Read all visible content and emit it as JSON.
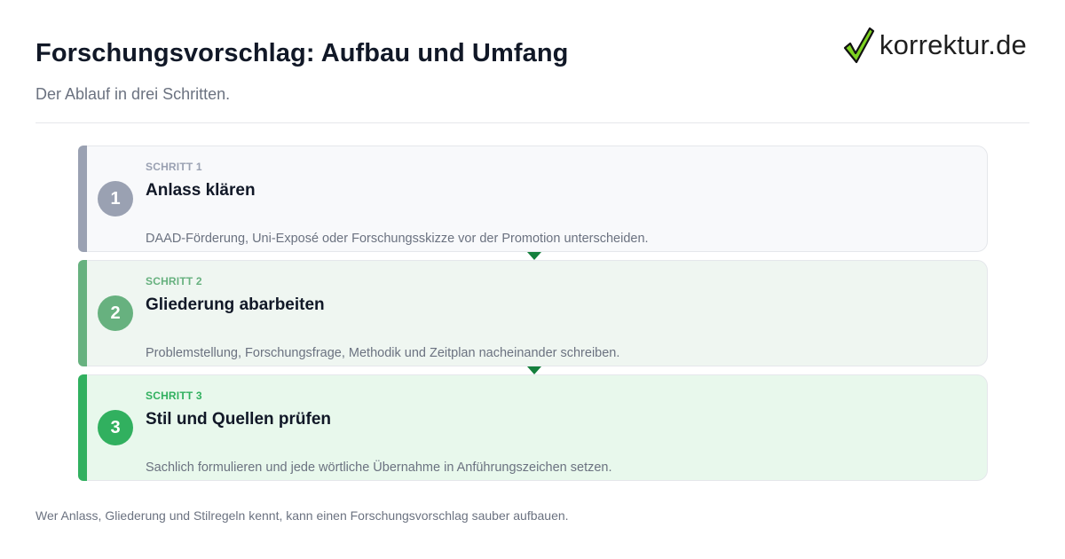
{
  "header": {
    "title": "Forschungsvorschlag: Aufbau und Umfang",
    "subtitle": "Der Ablauf in drei Schritten."
  },
  "logo": {
    "text": "korrektur.de",
    "icon": "checkmark-icon",
    "check_color": "#7ed321"
  },
  "steps": [
    {
      "label": "SCHRITT 1",
      "number": "1",
      "heading": "Anlass klären",
      "description": "DAAD-Förderung, Uni-Exposé oder Forschungsskizze vor der Promotion unterscheiden.",
      "color": "#9aa1b2"
    },
    {
      "label": "SCHRITT 2",
      "number": "2",
      "heading": "Gliederung abarbeiten",
      "description": "Problemstellung, Forschungsfrage, Methodik und Zeitplan nacheinander schreiben.",
      "color": "#67b17f"
    },
    {
      "label": "SCHRITT 3",
      "number": "3",
      "heading": "Stil und Quellen prüfen",
      "description": "Sachlich formulieren und jede wörtliche Übernahme in Anführungszeichen setzen.",
      "color": "#31b05f"
    }
  ],
  "footer": {
    "text": "Wer Anlass, Gliederung und Stilregeln kennt, kann einen Forschungsvorschlag sauber aufbauen."
  }
}
